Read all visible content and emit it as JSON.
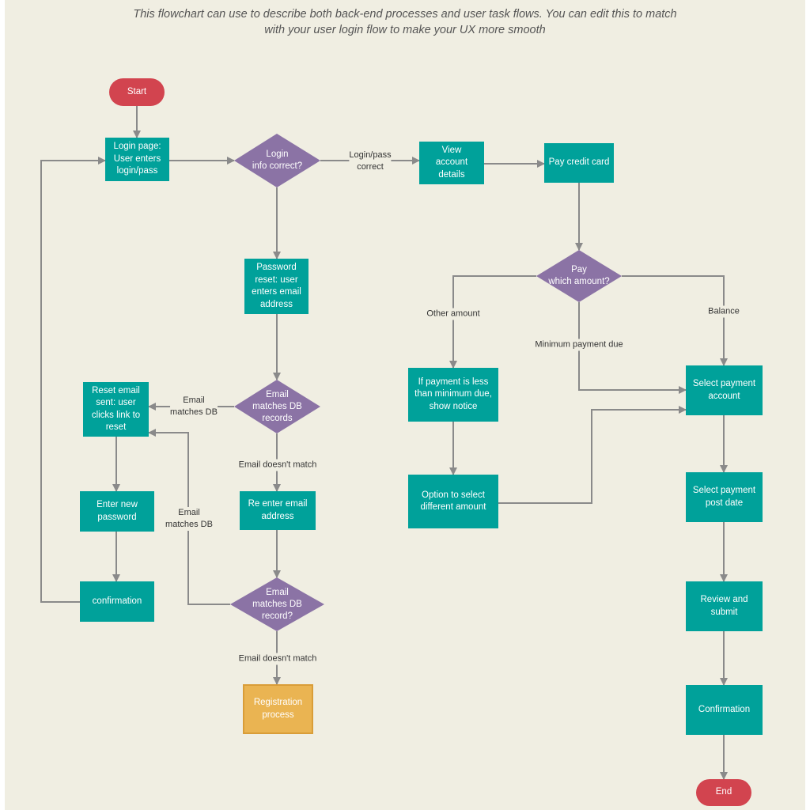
{
  "subtitle": {
    "line1": "This flowchart can use to describe both back-end processes and user task flows. You can edit this to match",
    "line2": "with your user login flow to make your UX more smooth"
  },
  "colors": {
    "background": "#f0eee2",
    "process": "#00a19a",
    "decision": "#8b73a5",
    "terminal": "#d2444f",
    "subprocess": "#eab452",
    "connector": "#8a8a8a"
  },
  "nodes": {
    "start": "Start",
    "login_page": "Login page:\nUser enters\nlogin/pass",
    "login_correct": "Login\ninfo correct?",
    "view_account": "View\naccount\ndetails",
    "pay_credit_card": "Pay credit card",
    "pay_which": "Pay\nwhich amount?",
    "password_reset": "Password\nreset: user\nenters email\naddress",
    "email_matches_1": "Email\nmatches  DB\nrecords",
    "reset_email_sent": "Reset email\nsent: user\nclicks link to\nreset",
    "enter_new_password": "Enter new\npassword",
    "confirmation_left": "confirmation",
    "re_enter_email": "Re enter email\naddress",
    "email_matches_2": "Email\nmatches  DB\nrecord?",
    "registration": "Registration\nprocess",
    "payment_less": "If payment is less\nthan minimum due,\nshow notice",
    "option_select": "Option to select\ndifferent amount",
    "select_account": "Select payment\naccount",
    "select_post_date": "Select payment\npost date",
    "review_submit": "Review and\nsubmit",
    "confirmation_right": "Confirmation",
    "end": "End"
  },
  "edge_labels": {
    "login_correct": "Login/pass\ncorrect",
    "email_matches_1": "Email\nmatches DB",
    "email_no_match_1": "Email doesn't match",
    "email_matches_2": "Email\nmatches DB",
    "email_no_match_2": "Email doesn't match",
    "other_amount": "Other amount",
    "minimum_due": "Minimum payment due",
    "balance": "Balance"
  }
}
